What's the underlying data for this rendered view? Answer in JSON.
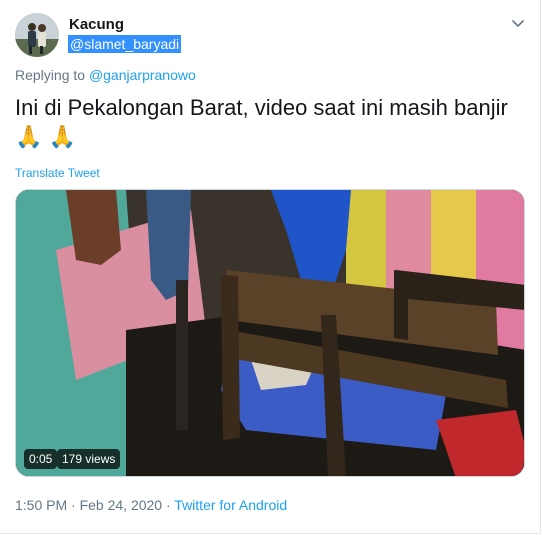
{
  "tweet": {
    "display_name": "Kacung",
    "handle": "@slamet_baryadi",
    "replying_prefix": "Replying to ",
    "replying_to": "@ganjarpranowo",
    "text": "Ini di Pekalongan Barat, video saat ini masih banjir",
    "emoji_1": "🙏",
    "emoji_2": "🙏",
    "translate_label": "Translate Tweet",
    "video": {
      "time": "0:05",
      "views": "179 views"
    },
    "timestamp": "1:50 PM · Feb 24, 2020",
    "separator": " · ",
    "source": "Twitter for Android"
  },
  "icons": {
    "menu": "chevron-down-icon",
    "emoji": "folded-hands-emoji"
  },
  "colors": {
    "link": "#1da1f2",
    "secondary_text": "#657786",
    "primary_text": "#14171a",
    "selection": "#3390ff"
  }
}
